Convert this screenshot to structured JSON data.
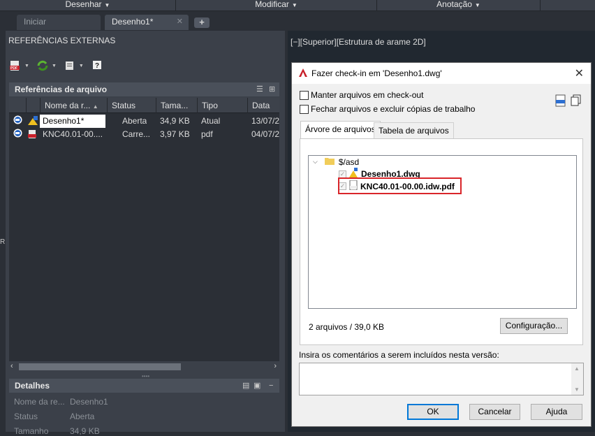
{
  "ribbon": {
    "items": [
      {
        "label": "Desenhar"
      },
      {
        "label": "Modificar"
      },
      {
        "label": "Anotação"
      }
    ]
  },
  "file_tabs": {
    "start": "Iniciar",
    "drawing": "Desenho1*",
    "close_glyph": "✕",
    "plus": "+"
  },
  "palette": {
    "title": "REFERÊNCIAS EXTERNAS",
    "file_refs_header": "Referências de arquivo",
    "columns": [
      "Nome da r...",
      "Status",
      "Tama...",
      "Tipo",
      "Data"
    ],
    "rows": [
      {
        "name": "Desenho1*",
        "status": "Aberta",
        "size": "34,9 KB",
        "type": "Atual",
        "date": "13/07/2"
      },
      {
        "name": "KNC40.01-00....",
        "status": "Carre...",
        "size": "3,97 KB",
        "type": "pdf",
        "date": "04/07/2"
      }
    ],
    "details_header": "Detalhes",
    "details": [
      {
        "label": "Nome da re...",
        "value": "Desenho1"
      },
      {
        "label": "Status",
        "value": "Aberta"
      },
      {
        "label": "Tamanho",
        "value": "34,9 KB"
      }
    ],
    "minus": "−"
  },
  "viewport": {
    "label": "[−][Superior][Estrutura de arame 2D]"
  },
  "dialog": {
    "title": "Fazer check-in em 'Desenho1.dwg'",
    "keep_checked_out": "Manter arquivos em check-out",
    "close_and_delete": "Fechar arquivos e excluir cópias de trabalho",
    "tab_tree": "Árvore de arquivos",
    "tab_table": "Tabela de arquivos",
    "tree": {
      "folder": "$/asd",
      "files": [
        "Desenho1.dwg",
        "KNC40.01-00.00.idw.pdf"
      ]
    },
    "count": "2 arquivos / 39,0 KB",
    "config_button": "Configuração...",
    "comment_label": "Insira os comentários a serem incluídos nesta versão:",
    "comment_value": "",
    "ok": "OK",
    "cancel": "Cancelar",
    "help": "Ajuda"
  },
  "colors": {
    "highlight": "#d9252a",
    "accent": "#0078d7"
  }
}
